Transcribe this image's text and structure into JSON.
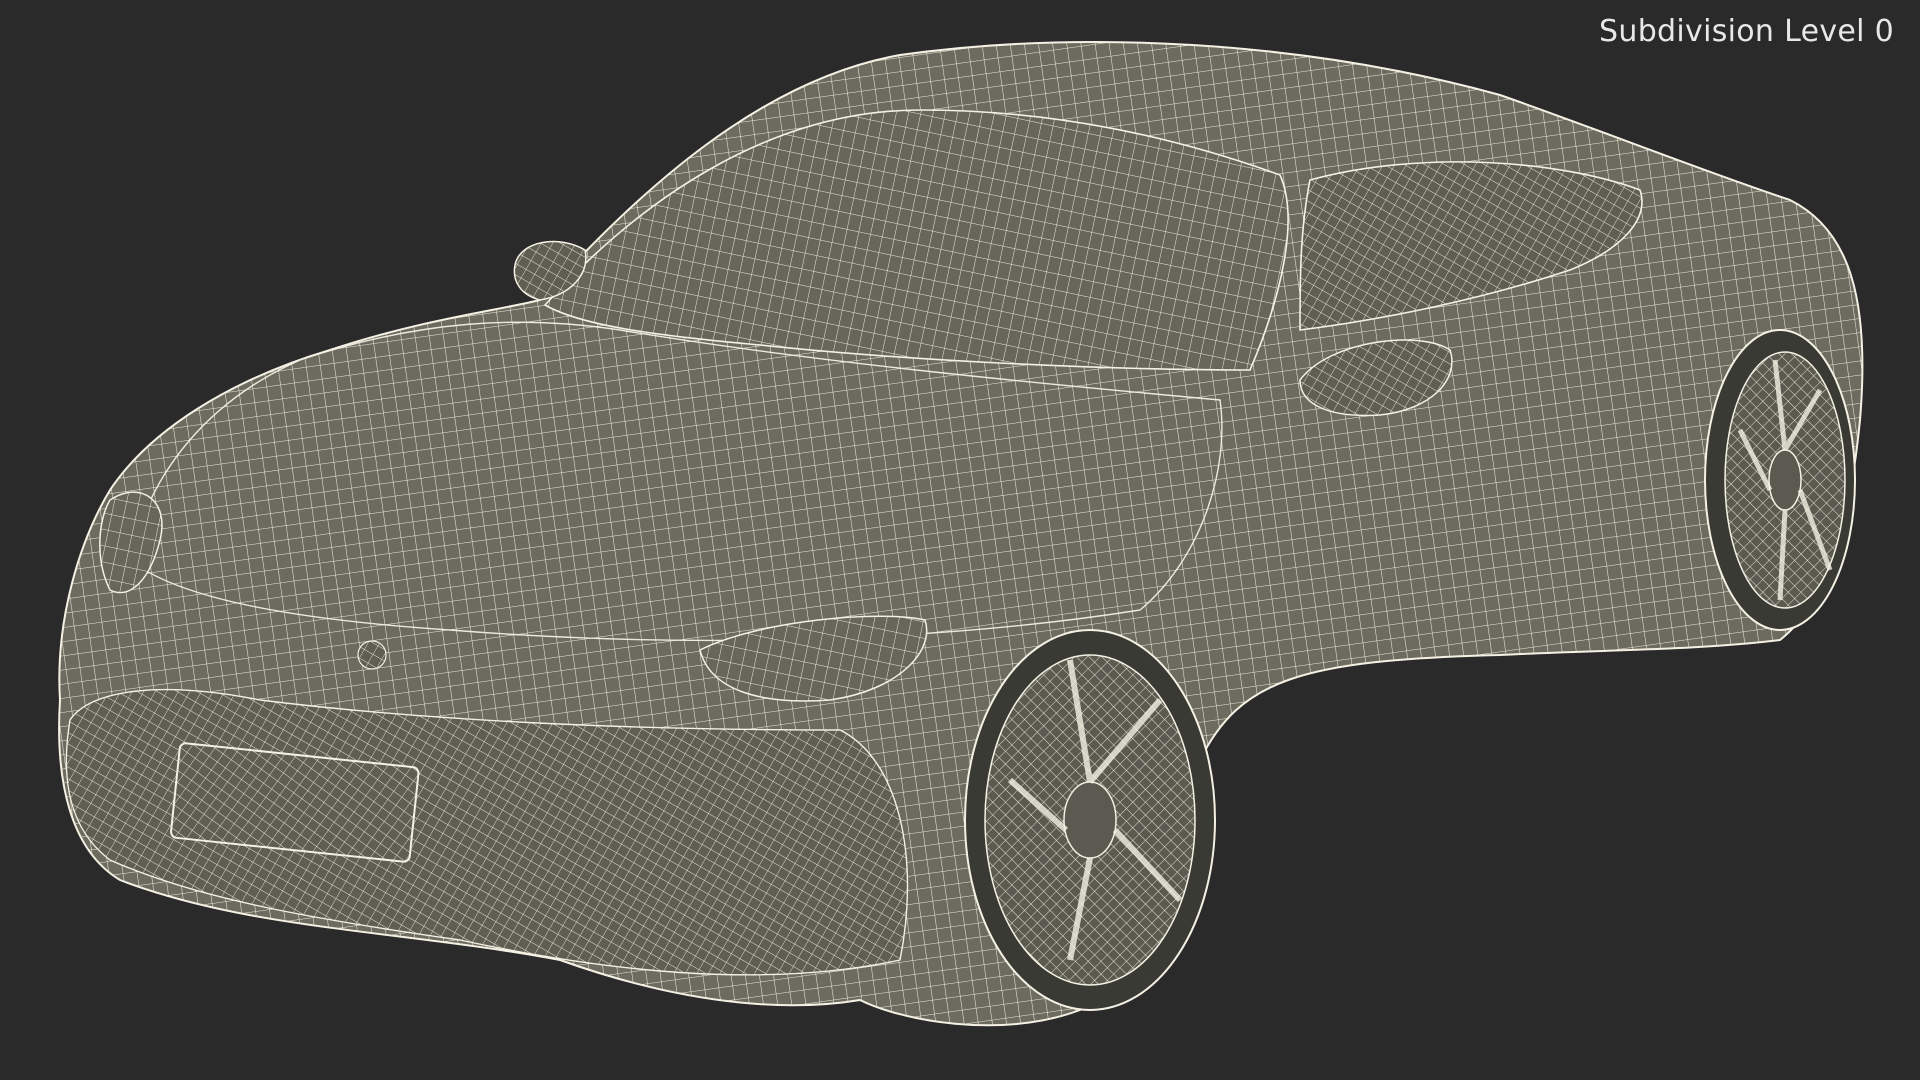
{
  "viewport": {
    "label": "Subdivision Level 0",
    "background_color": "#2a2a2a",
    "model_fill_color": "#6a6a5e",
    "wire_color": "#f4f1e4"
  },
  "model": {
    "subject": "sports-car-wireframe"
  }
}
